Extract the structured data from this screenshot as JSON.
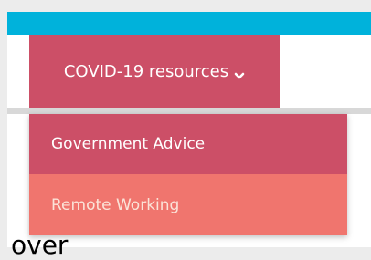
{
  "colors": {
    "accent_bar": "#00b2db",
    "menu_primary": "#cc4f67",
    "menu_hover": "#f0756e",
    "page_bg": "#ececec"
  },
  "nav": {
    "menu_button_label": "COVID-19 resources",
    "menu_icon": "chevron-down-icon"
  },
  "dropdown": {
    "items": [
      {
        "label": "Government Advice"
      },
      {
        "label": "Remote Working"
      }
    ]
  },
  "content": {
    "heading_partial": "over"
  }
}
